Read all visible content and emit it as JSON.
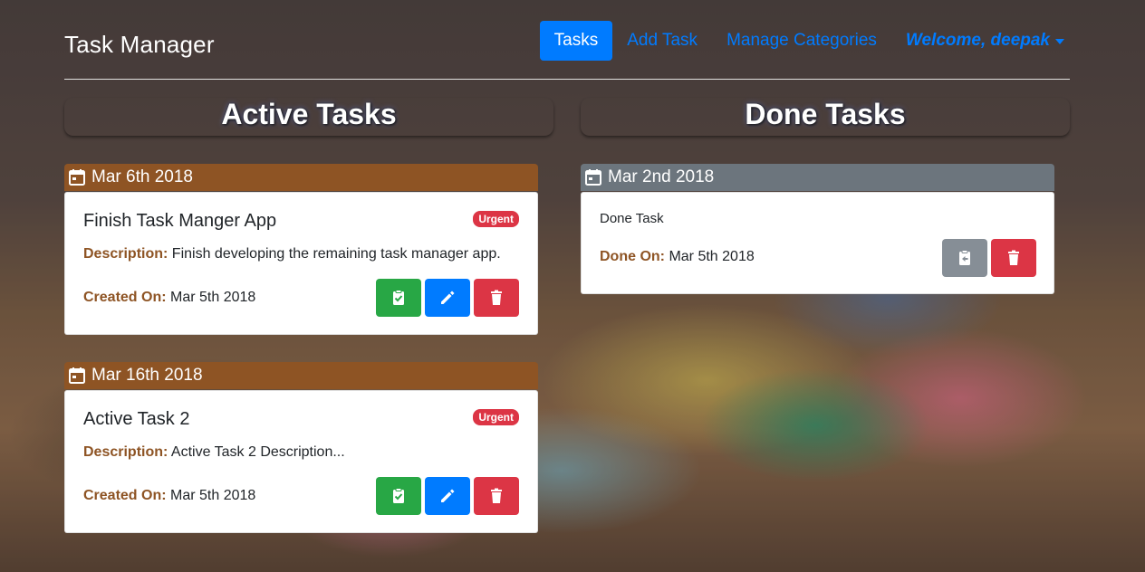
{
  "app": {
    "brand": "Task Manager"
  },
  "nav": {
    "tasks": "Tasks",
    "add_task": "Add Task",
    "manage_categories": "Manage Categories",
    "welcome": "Welcome, deepak"
  },
  "columns": {
    "active_title": "Active Tasks",
    "done_title": "Done Tasks"
  },
  "labels": {
    "description": "Description:",
    "created_on": "Created On:",
    "done_on": "Done On:"
  },
  "active_tasks": [
    {
      "date": "Mar 6th 2018",
      "title": "Finish Task Manger App",
      "badge": "Urgent",
      "description": "Finish developing the remaining task manager app.",
      "created_on": "Mar 5th 2018"
    },
    {
      "date": "Mar 16th 2018",
      "title": "Active Task 2",
      "badge": "Urgent",
      "description": "Active Task 2 Description...",
      "created_on": "Mar 5th 2018"
    }
  ],
  "done_tasks": [
    {
      "date": "Mar 2nd 2018",
      "title": "Done Task",
      "done_on": "Mar 5th 2018"
    }
  ],
  "icons": {
    "calendar": "calendar-icon",
    "complete": "clipboard-check-icon",
    "edit": "pencil-icon",
    "delete": "trash-icon",
    "undo": "clipboard-return-icon",
    "caret": "caret-down-icon"
  },
  "colors": {
    "primary": "#007bff",
    "success": "#28a745",
    "danger": "#dc3545",
    "secondary": "#6c757d",
    "brown": "#8e5424"
  }
}
